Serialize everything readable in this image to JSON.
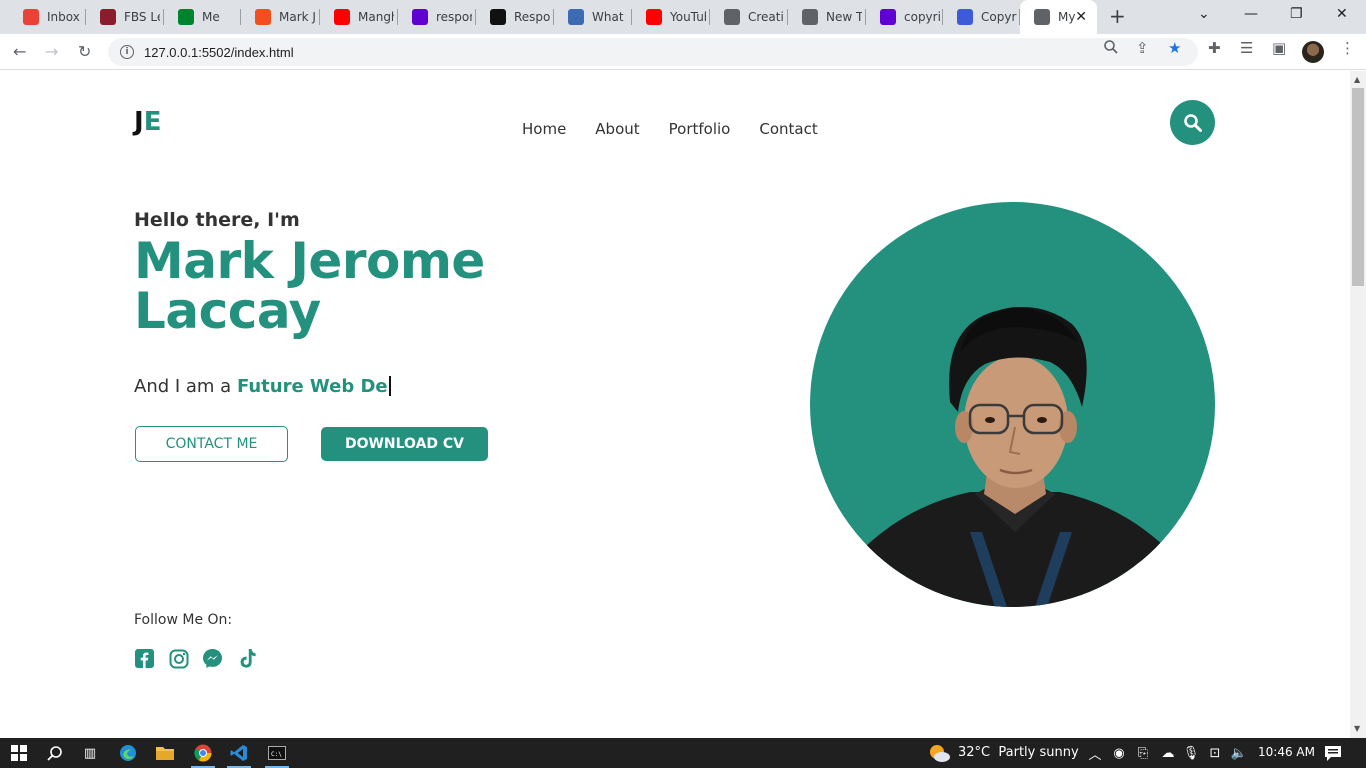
{
  "browser": {
    "tabs": [
      {
        "title": "Inbox (",
        "icon": "gmail-icon",
        "color": "#ea4335"
      },
      {
        "title": "FBS Le",
        "icon": "fbs-icon",
        "color": "#8b1c2b"
      },
      {
        "title": "Me",
        "icon": "google-meet-icon",
        "color": "#00832d"
      },
      {
        "title": "Mark Je",
        "icon": "figma-icon",
        "color": "#f24e1e"
      },
      {
        "title": "Mangh",
        "icon": "youtube-icon",
        "color": "#ff0000"
      },
      {
        "title": "respon",
        "icon": "yahoo-icon",
        "color": "#6001d2"
      },
      {
        "title": "Respon",
        "icon": "medium-icon",
        "color": "#111111"
      },
      {
        "title": "What Is",
        "icon": "fx-icon",
        "color": "#3d6bb3"
      },
      {
        "title": "YouTub",
        "icon": "youtube-icon",
        "color": "#ff0000"
      },
      {
        "title": "Creativ",
        "icon": "globe-icon",
        "color": "#5f6368"
      },
      {
        "title": "New Ta",
        "icon": "globe-icon",
        "color": "#5f6368"
      },
      {
        "title": "copyrig",
        "icon": "yahoo-icon",
        "color": "#6001d2"
      },
      {
        "title": "Copyrig",
        "icon": "s-icon",
        "color": "#3d5bd9"
      },
      {
        "title": "My",
        "icon": "globe-icon",
        "color": "#5f6368",
        "active": true
      }
    ],
    "url": "127.0.0.1:5502/index.html"
  },
  "site": {
    "logo_first": "J",
    "logo_second": "E",
    "nav": [
      "Home",
      "About",
      "Portfolio",
      "Contact"
    ],
    "greeting": "Hello there, I'm",
    "name_line1": "Mark Jerome",
    "name_line2": "Laccay",
    "role_prefix": "And I am a ",
    "role_typed": "Future Web De",
    "contact_button": "CONTACT ME",
    "download_button": "DOWNLOAD CV",
    "follow_label": "Follow Me On:",
    "socials": [
      "facebook-icon",
      "instagram-icon",
      "messenger-icon",
      "tiktok-icon"
    ],
    "accent_color": "#23917d"
  },
  "taskbar": {
    "weather_temp": "32°C",
    "weather_desc": "Partly sunny",
    "time": "10:46 AM"
  }
}
